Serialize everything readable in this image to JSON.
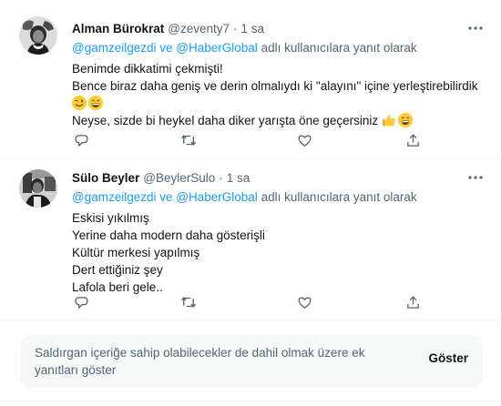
{
  "tweets": [
    {
      "name": "Alman Bürokrat",
      "handle": "@zeventy7",
      "dot": "·",
      "time": "1 sa",
      "reply_mention_1": "@gamzeilgezdi",
      "reply_and": "ve",
      "reply_mention_2": "@HaberGlobal",
      "reply_suffix": "adlı kullanıcılara yanıt olarak",
      "lines": [
        "Benimde dikkatimi çekmişti!",
        "Bence biraz daha geniş ve derin olmalıydı ki \"alayını\" içine yerleştirebilirdik",
        "",
        "Neyse, sizde bi heykel daha diker yarışta öne geçersiniz"
      ],
      "icons": {
        "more": "more-icon",
        "reply": "reply-icon",
        "retweet": "retweet-icon",
        "like": "heart-icon",
        "share": "share-icon"
      }
    },
    {
      "name": "Sülo Beyler",
      "handle": "@BeylerSulo",
      "dot": "·",
      "time": "1 sa",
      "reply_mention_1": "@gamzeilgezdi",
      "reply_and": "ve",
      "reply_mention_2": "@HaberGlobal",
      "reply_suffix": "adlı kullanıcılara yanıt olarak",
      "lines": [
        "Eskisi yıkılmış",
        "Yerine daha modern daha gösterişli",
        "Kültür merkesi yapılmış",
        "Dert ettiğiniz şey",
        "Lafola beri gele.."
      ],
      "icons": {
        "more": "more-icon",
        "reply": "reply-icon",
        "retweet": "retweet-icon",
        "like": "heart-icon",
        "share": "share-icon"
      }
    }
  ],
  "notice": {
    "text": "Saldırgan içeriğe sahip olabilecekler de dahil olmak üzere ek yanıtları göster",
    "button": "Göster"
  },
  "colors": {
    "accent": "#1d9bf0",
    "text_primary": "#0f1419",
    "text_secondary": "#536471",
    "notice_bg": "#f7f9f9",
    "divider": "#eff3f4",
    "emoji_yellow": "#ffcc33"
  }
}
